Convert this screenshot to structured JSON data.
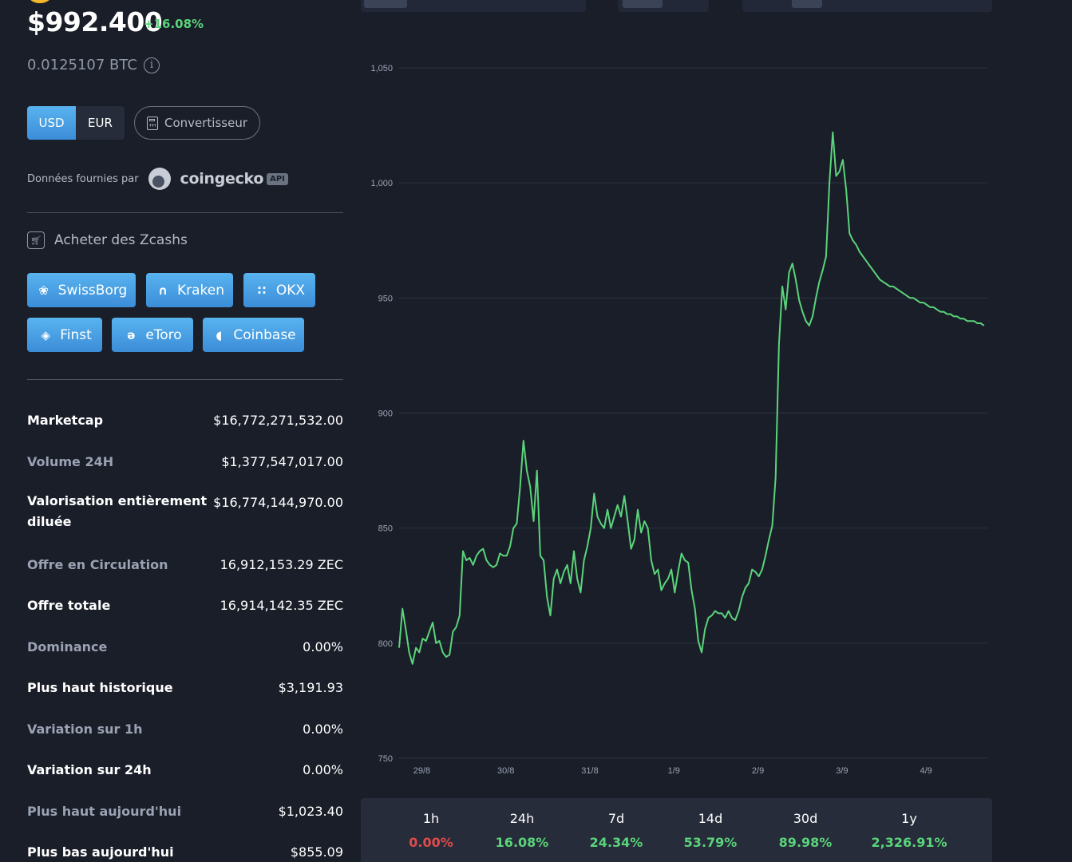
{
  "header": {
    "price": "$992.400",
    "change_24h": "+16.08%",
    "btc_price": "0.0125107 BTC"
  },
  "currency": {
    "options": [
      "USD",
      "EUR"
    ],
    "selected": "USD"
  },
  "converter_label": "Convertisseur",
  "provider": {
    "label": "Données fournies par",
    "name": "coingecko",
    "badge": "API"
  },
  "buy": {
    "title": "Acheter des Zcashs",
    "exchanges": [
      "SwissBorg",
      "Kraken",
      "OKX",
      "Finst",
      "eToro",
      "Coinbase"
    ]
  },
  "stats": [
    {
      "label": "Marketcap",
      "value": "$16,772,271,532.00"
    },
    {
      "label": "Volume 24H",
      "value": "$1,377,547,017.00"
    },
    {
      "label": "Valorisation entièrement",
      "label2": "diluée",
      "value": "$16,774,144,970.00"
    },
    {
      "label": "Offre en Circulation",
      "value": "16,912,153.29 ZEC"
    },
    {
      "label": "Offre totale",
      "value": "16,914,142.35 ZEC"
    },
    {
      "label": "Dominance",
      "value": "0.00%"
    },
    {
      "label": "Plus haut historique",
      "value": "$3,191.93"
    },
    {
      "label": "Variation sur 1h",
      "value": "0.00%"
    },
    {
      "label": "Variation sur 24h",
      "value": "0.00%"
    },
    {
      "label": "Plus haut aujourd'hui",
      "value": "$1,023.40"
    },
    {
      "label": "Plus bas aujourd'hui",
      "value": "$855.09"
    }
  ],
  "performance": [
    {
      "period": "1h",
      "value": "0.00%",
      "color": "#e04b4b"
    },
    {
      "period": "24h",
      "value": "16.08%",
      "color": "#5ad47a"
    },
    {
      "period": "7d",
      "value": "24.34%",
      "color": "#5ad47a"
    },
    {
      "period": "14d",
      "value": "53.79%",
      "color": "#5ad47a"
    },
    {
      "period": "30d",
      "value": "89.98%",
      "color": "#5ad47a"
    },
    {
      "period": "1y",
      "value": "2,326.91%",
      "color": "#5ad47a"
    }
  ],
  "colors": {
    "line": "#5ad47a",
    "accent": "#4aa3e6",
    "negative": "#e04b4b"
  },
  "chart_data": {
    "type": "line",
    "title": "",
    "xlabel": "",
    "ylabel": "",
    "ylim": [
      750,
      1050
    ],
    "yticks": [
      750,
      800,
      850,
      900,
      950,
      1000,
      1050
    ],
    "ytick_labels": [
      "750",
      "800",
      "850",
      "900",
      "950",
      "1,000",
      "1,050"
    ],
    "xticks": [
      0.27,
      1.27,
      2.27,
      3.27,
      4.27,
      5.27,
      6.27
    ],
    "xtick_labels": [
      "29/8",
      "30/8",
      "31/8",
      "1/9",
      "2/9",
      "3/9",
      "4/9"
    ],
    "xlim": [
      0,
      7
    ],
    "grid": true,
    "x": [
      0,
      0.04,
      0.08,
      0.12,
      0.16,
      0.2,
      0.24,
      0.28,
      0.32,
      0.36,
      0.4,
      0.44,
      0.48,
      0.52,
      0.56,
      0.6,
      0.64,
      0.68,
      0.72,
      0.76,
      0.8,
      0.84,
      0.88,
      0.92,
      0.96,
      1.0,
      1.04,
      1.08,
      1.12,
      1.16,
      1.2,
      1.24,
      1.28,
      1.32,
      1.36,
      1.4,
      1.44,
      1.48,
      1.52,
      1.56,
      1.6,
      1.64,
      1.68,
      1.72,
      1.76,
      1.8,
      1.84,
      1.88,
      1.92,
      1.96,
      2.0,
      2.04,
      2.08,
      2.12,
      2.16,
      2.2,
      2.24,
      2.28,
      2.32,
      2.36,
      2.4,
      2.44,
      2.48,
      2.52,
      2.56,
      2.6,
      2.64,
      2.68,
      2.72,
      2.76,
      2.8,
      2.84,
      2.88,
      2.92,
      2.96,
      3.0,
      3.04,
      3.08,
      3.12,
      3.16,
      3.2,
      3.24,
      3.28,
      3.32,
      3.36,
      3.4,
      3.44,
      3.48,
      3.52,
      3.56,
      3.6,
      3.64,
      3.68,
      3.72,
      3.76,
      3.8,
      3.84,
      3.88,
      3.92,
      3.96,
      4.0,
      4.04,
      4.08,
      4.12,
      4.16,
      4.2,
      4.24,
      4.28,
      4.32,
      4.36,
      4.4,
      4.44,
      4.48,
      4.52,
      4.56,
      4.6,
      4.64,
      4.68,
      4.72,
      4.76,
      4.8,
      4.84,
      4.88,
      4.92,
      4.96,
      5.0,
      5.04,
      5.08,
      5.12,
      5.16,
      5.2,
      5.24,
      5.28,
      5.32,
      5.36,
      5.4,
      5.44,
      5.48,
      5.52,
      5.56,
      5.6,
      5.64,
      5.68,
      5.72,
      5.76,
      5.8,
      5.84,
      5.88,
      5.92,
      5.96,
      6.0,
      6.04,
      6.08,
      6.12,
      6.16,
      6.2,
      6.24,
      6.28,
      6.32,
      6.36,
      6.4,
      6.44,
      6.48,
      6.52,
      6.56,
      6.6,
      6.64,
      6.68,
      6.72,
      6.76,
      6.8,
      6.84,
      6.88,
      6.92,
      6.96,
      7.0
    ],
    "values": [
      798,
      815,
      806,
      796,
      791,
      798,
      796,
      802,
      801,
      805,
      809,
      800,
      801,
      796,
      794,
      795,
      805,
      807,
      812,
      840,
      836,
      837,
      834,
      838,
      840,
      841,
      836,
      834,
      833,
      834,
      839,
      838,
      838,
      842,
      850,
      852,
      868,
      888,
      875,
      868,
      853,
      875,
      838,
      836,
      820,
      812,
      828,
      832,
      826,
      831,
      834,
      826,
      840,
      828,
      822,
      836,
      842,
      850,
      865,
      855,
      852,
      850,
      858,
      850,
      855,
      860,
      855,
      864,
      853,
      841,
      845,
      858,
      848,
      853,
      850,
      836,
      830,
      832,
      823,
      826,
      828,
      832,
      822,
      831,
      839,
      836,
      835,
      823,
      815,
      801,
      796,
      806,
      811,
      812,
      814,
      813,
      813,
      811,
      814,
      811,
      810,
      814,
      820,
      824,
      826,
      832,
      831,
      829,
      832,
      838,
      845,
      851,
      872,
      930,
      955,
      945,
      961,
      965,
      958,
      949,
      944,
      940,
      938,
      942,
      950,
      957,
      962,
      968,
      1000,
      1022,
      1003,
      1005,
      1010,
      997,
      978,
      975,
      973,
      970,
      968,
      966,
      964,
      962,
      960,
      958,
      957,
      956,
      955,
      955,
      954,
      953,
      952,
      951,
      950,
      950,
      949,
      948,
      948,
      947,
      946,
      946,
      945,
      944,
      944,
      943,
      943,
      942,
      942,
      941,
      941,
      940,
      940,
      940,
      939,
      939,
      938,
      938
    ]
  }
}
